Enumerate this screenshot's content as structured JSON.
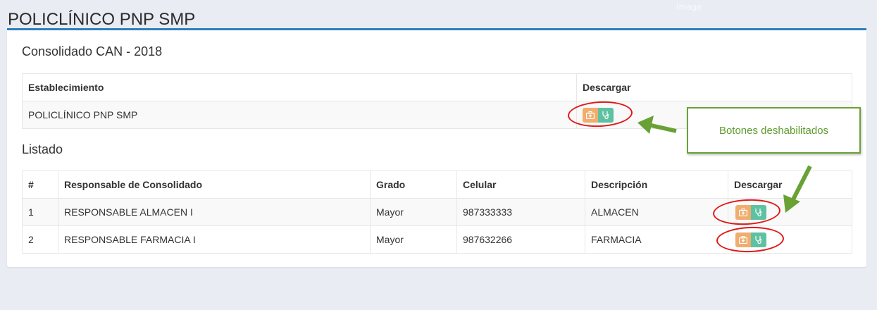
{
  "header": {
    "title": "POLICLÍNICO PNP SMP",
    "ghost_text": "Image"
  },
  "consolidado": {
    "heading": "Consolidado CAN - 2018",
    "columns": [
      "Establecimiento",
      "Descargar"
    ],
    "rows": [
      {
        "establecimiento": "POLICLÍNICO PNP SMP"
      }
    ]
  },
  "listado": {
    "heading": "Listado",
    "columns": [
      "#",
      "Responsable de Consolidado",
      "Grado",
      "Celular",
      "Descripción",
      "Descargar"
    ],
    "rows": [
      {
        "num": "1",
        "responsable": "RESPONSABLE ALMACEN I",
        "grado": "Mayor",
        "celular": "987333333",
        "descripcion": "ALMACEN"
      },
      {
        "num": "2",
        "responsable": "RESPONSABLE FARMACIA I",
        "grado": "Mayor",
        "celular": "987632266",
        "descripcion": "FARMACIA"
      }
    ]
  },
  "annotation": {
    "label": "Botones deshabilitados"
  },
  "buttons": {
    "primary_icon": "medkit-icon",
    "secondary_icon": "stethoscope-icon",
    "orange": "#f0ad6e",
    "teal": "#5ec2a2",
    "state": "disabled"
  },
  "colors": {
    "accent": "#2e7fb8",
    "annotation_ring": "#e01818",
    "annotation_arrow": "#6aa136"
  }
}
